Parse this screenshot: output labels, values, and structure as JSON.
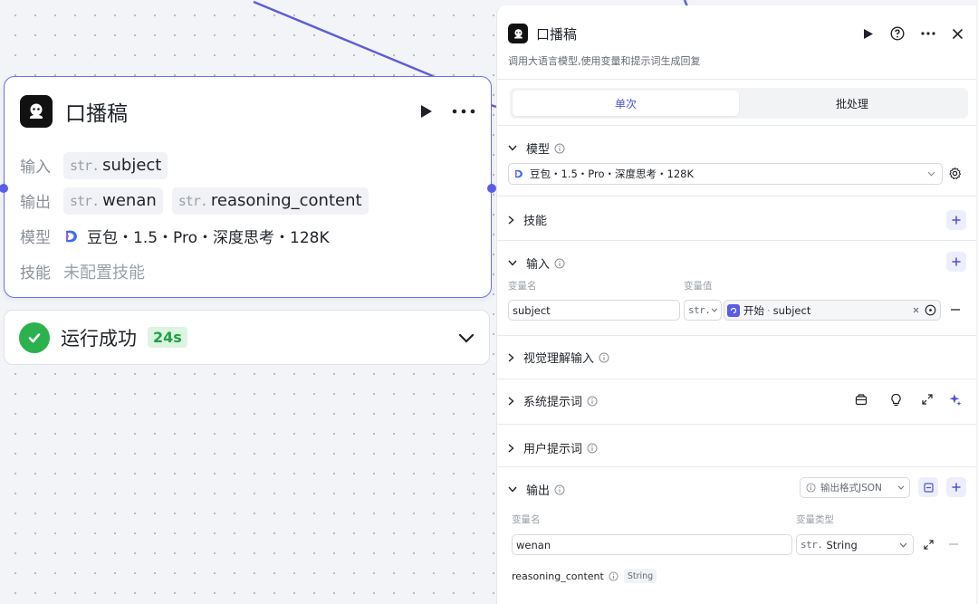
{
  "node": {
    "title": "口播稿",
    "rows": {
      "input_label": "输入",
      "output_label": "输出",
      "model_label": "模型",
      "skill_label": "技能"
    },
    "type_prefix": "str.",
    "inputs": [
      "subject"
    ],
    "outputs": [
      "wenan",
      "reasoning_content"
    ],
    "model": "豆包・1.5・Pro・深度思考・128K",
    "skill_value": "未配置技能"
  },
  "run": {
    "status_text": "运行成功",
    "duration": "24s"
  },
  "panel": {
    "title": "口播稿",
    "description": "调用大语言模型,使用变量和提示词生成回复",
    "tabs": [
      {
        "label": "单次",
        "active": true
      },
      {
        "label": "批处理",
        "active": false
      }
    ],
    "sections": {
      "model": "模型",
      "skills": "技能",
      "input": "输入",
      "vision": "视觉理解输入",
      "system_prompt": "系统提示词",
      "user_prompt": "用户提示词",
      "output": "输出"
    },
    "model_select": "豆包・1.5・Pro・深度思考・128K",
    "input_table": {
      "col_name": "变量名",
      "col_value": "变量值",
      "var_name": "subject",
      "var_type": "str.",
      "ref_source": "开始",
      "ref_var": "subject"
    },
    "output_format": "输出格式JSON",
    "output_table": {
      "col_name": "变量名",
      "col_type": "变量类型",
      "var_name": "wenan",
      "type_prefix": "str.",
      "type_value": "String",
      "extra_name": "reasoning_content",
      "extra_type": "String"
    }
  },
  "colors": {
    "accent": "#5a5ce8",
    "success": "#2bb24c",
    "edge": "#5c5ed6"
  }
}
